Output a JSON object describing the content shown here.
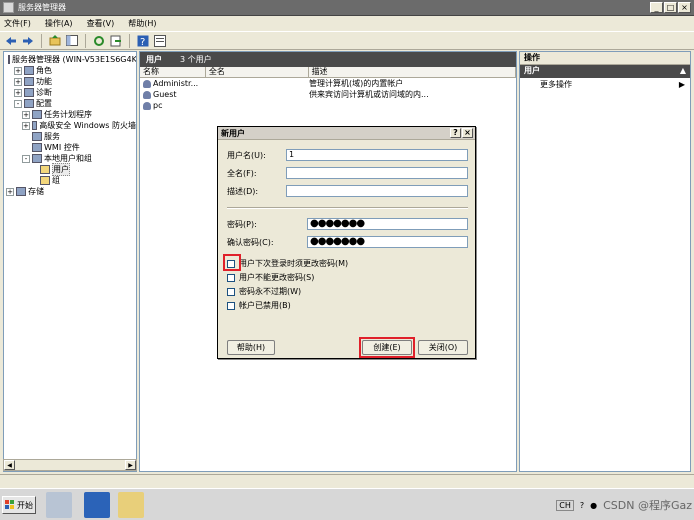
{
  "window": {
    "title": "服务器管理器",
    "controls": [
      "_",
      "□",
      "×"
    ]
  },
  "menu": [
    "文件(F)",
    "操作(A)",
    "查看(V)",
    "帮助(H)"
  ],
  "toolbar": {
    "items": [
      "back-icon",
      "forward-icon",
      "up-icon",
      "show-hide-tree-icon",
      "refresh-icon",
      "export-icon",
      "help-icon",
      "properties-icon"
    ]
  },
  "tree": {
    "items": [
      {
        "label": "服务器管理器 (WIN-V53E1S6G4K",
        "indent": 0,
        "exp": ""
      },
      {
        "label": "角色",
        "indent": 1,
        "exp": "+"
      },
      {
        "label": "功能",
        "indent": 1,
        "exp": "+"
      },
      {
        "label": "诊断",
        "indent": 1,
        "exp": "+"
      },
      {
        "label": "配置",
        "indent": 1,
        "exp": "-"
      },
      {
        "label": "任务计划程序",
        "indent": 2,
        "exp": "+"
      },
      {
        "label": "高级安全 Windows 防火墙",
        "indent": 2,
        "exp": "+"
      },
      {
        "label": "服务",
        "indent": 2,
        "exp": ""
      },
      {
        "label": "WMI 控件",
        "indent": 2,
        "exp": ""
      },
      {
        "label": "本地用户和组",
        "indent": 2,
        "exp": "-"
      },
      {
        "label": "用户",
        "indent": 3,
        "exp": "",
        "selected": true
      },
      {
        "label": "组",
        "indent": 3,
        "exp": ""
      },
      {
        "label": "存储",
        "indent": 0,
        "exp": "+"
      }
    ]
  },
  "content": {
    "header_title": "用户",
    "header_count": "3 个用户",
    "columns": [
      "名称",
      "全名",
      "描述"
    ],
    "rows": [
      {
        "name": "Administr...",
        "fullname": "",
        "desc": "管理计算机(域)的内置帐户"
      },
      {
        "name": "Guest",
        "fullname": "",
        "desc": "供来宾访问计算机或访问域的内..."
      },
      {
        "name": "pc",
        "fullname": "",
        "desc": ""
      }
    ]
  },
  "actions": {
    "title": "操作",
    "section": "用户",
    "items": [
      "更多操作"
    ]
  },
  "dialog": {
    "title": "新用户",
    "help_glyph": "?",
    "close_glyph": "×",
    "username_label": "用户名(U):",
    "username_value": "1",
    "fullname_label": "全名(F):",
    "fullname_value": "",
    "desc_label": "描述(D):",
    "desc_value": "",
    "password_label": "密码(P):",
    "password_value": "●●●●●●●",
    "confirm_label": "确认密码(C):",
    "confirm_value": "●●●●●●●",
    "checks": [
      {
        "label": "用户下次登录时须更改密码(M)",
        "checked": false
      },
      {
        "label": "用户不能更改密码(S)",
        "checked": false
      },
      {
        "label": "密码永不过期(W)",
        "checked": false
      },
      {
        "label": "帐户已禁用(B)",
        "checked": false
      }
    ],
    "help_button": "帮助(H)",
    "create_button": "创建(E)",
    "close_button": "关闭(O)"
  },
  "taskbar": {
    "start_label": "开始",
    "tray_text": "CH",
    "watermark": "CSDN @程序Gaz"
  }
}
